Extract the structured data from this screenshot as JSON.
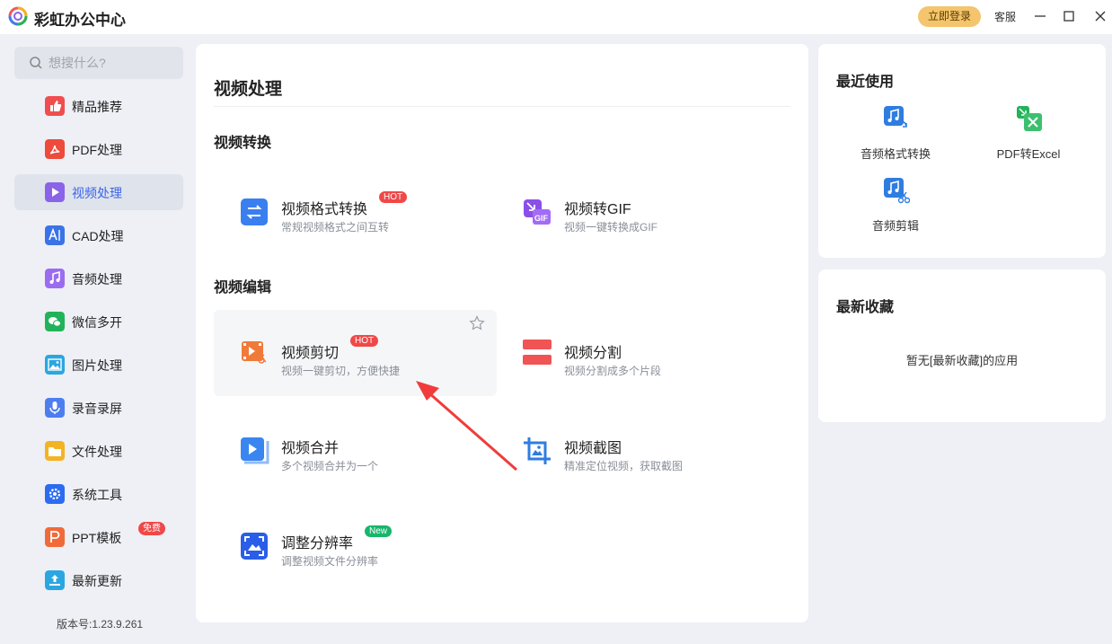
{
  "app": {
    "title": "彩虹办公中心"
  },
  "header": {
    "login_label": "立即登录",
    "service_label": "客服"
  },
  "search": {
    "placeholder": "想搜什么?"
  },
  "sidebar": {
    "items": [
      {
        "label": "精品推荐",
        "icon": "thumbs-up-icon",
        "color": "#f04e4e"
      },
      {
        "label": "PDF处理",
        "icon": "pdf-icon",
        "color": "#ee4b3d"
      },
      {
        "label": "视频处理",
        "icon": "video-play-icon",
        "color": "#8b63e8",
        "active": true
      },
      {
        "label": "CAD处理",
        "icon": "cad-icon",
        "color": "#3a73e8"
      },
      {
        "label": "音频处理",
        "icon": "music-icon",
        "color": "#9b6cf0"
      },
      {
        "label": "微信多开",
        "icon": "wechat-icon",
        "color": "#22b35a"
      },
      {
        "label": "图片处理",
        "icon": "image-icon",
        "color": "#2ba6e0"
      },
      {
        "label": "录音录屏",
        "icon": "microphone-icon",
        "color": "#4d7ef0"
      },
      {
        "label": "文件处理",
        "icon": "folder-icon",
        "color": "#f4b323"
      },
      {
        "label": "系统工具",
        "icon": "gear-icon",
        "color": "#2b6cf0"
      },
      {
        "label": "PPT模板",
        "icon": "ppt-icon",
        "color": "#f06a3a",
        "badge": "免费"
      },
      {
        "label": "最新更新",
        "icon": "upload-icon",
        "color": "#2ba6e0"
      }
    ]
  },
  "version": "版本号:1.23.9.261",
  "main": {
    "title": "视频处理",
    "sections": [
      {
        "title": "视频转换"
      },
      {
        "title": "视频编辑"
      }
    ],
    "tools": [
      {
        "name": "视频格式转换",
        "desc": "常规视频格式之间互转",
        "badge": "HOT",
        "icon": "convert-icon",
        "color": "#3a7ff0"
      },
      {
        "name": "视频转GIF",
        "desc": "视频一键转换成GIF",
        "icon": "gif-icon",
        "color": "#8b4fe8"
      },
      {
        "name": "视频剪切",
        "desc": "视频一键剪切，方便快捷",
        "badge": "HOT",
        "icon": "video-cut-icon",
        "color": "#f07a3a"
      },
      {
        "name": "视频分割",
        "desc": "视频分割成多个片段",
        "icon": "split-icon",
        "color": "#f05454"
      },
      {
        "name": "视频合并",
        "desc": "多个视频合并为一个",
        "icon": "merge-icon",
        "color": "#3a86f0"
      },
      {
        "name": "视频截图",
        "desc": "精准定位视频，获取截图",
        "icon": "screenshot-icon",
        "color": "#2f7de0"
      },
      {
        "name": "调整分辨率",
        "desc": "调整视频文件分辨率",
        "badge": "New",
        "icon": "resolution-icon",
        "color": "#2a5ee8"
      }
    ]
  },
  "recent": {
    "title": "最近使用",
    "items": [
      {
        "label": "音频格式转换",
        "icon": "audio-convert-icon"
      },
      {
        "label": "PDF转Excel",
        "icon": "excel-icon"
      },
      {
        "label": "音频剪辑",
        "icon": "audio-cut-icon"
      }
    ]
  },
  "favorites": {
    "title": "最新收藏",
    "empty_text": "暂无[最新收藏]的应用"
  }
}
